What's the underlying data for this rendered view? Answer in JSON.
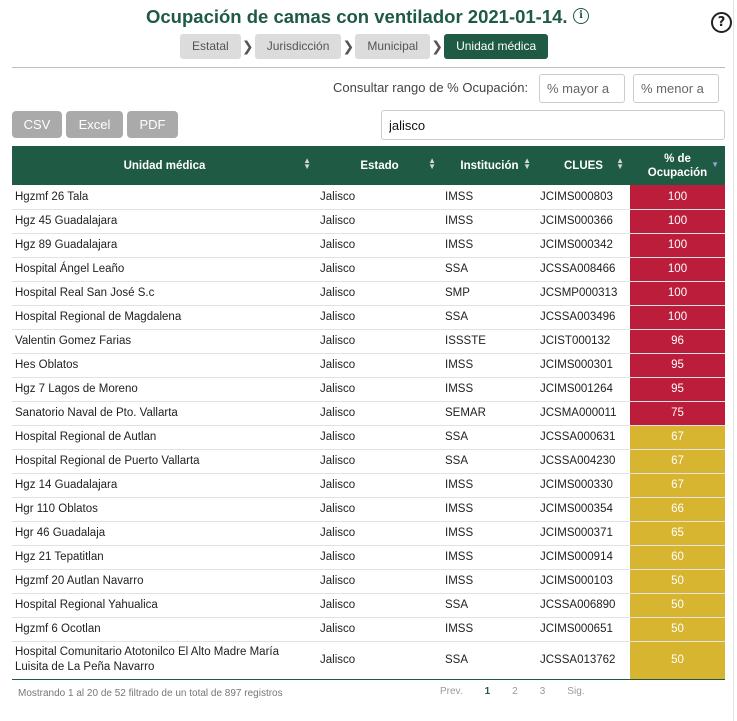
{
  "header": {
    "title": "Ocupación de camas con ventilador 2021-01-14.",
    "info_icon": "i",
    "help_icon": "?"
  },
  "breadcrumbs": [
    {
      "label": "Estatal",
      "active": false
    },
    {
      "label": "Jurisdicción",
      "active": false
    },
    {
      "label": "Municipal",
      "active": false
    },
    {
      "label": "Unidad médica",
      "active": true
    }
  ],
  "breadcrumb_separator": "❯",
  "range": {
    "label": "Consultar rango de % Ocupación:",
    "min_placeholder": "% mayor a",
    "max_placeholder": "% menor a"
  },
  "export_buttons": {
    "csv": "CSV",
    "excel": "Excel",
    "pdf": "PDF"
  },
  "search": {
    "value": "jalisco"
  },
  "table": {
    "columns": [
      "Unidad médica",
      "Estado",
      "Institución",
      "CLUES",
      "% de Ocupación"
    ],
    "rows": [
      [
        "Hgzmf 26 Tala",
        "Jalisco",
        "IMSS",
        "JCIMS000803",
        "100"
      ],
      [
        "Hgz 45 Guadalajara",
        "Jalisco",
        "IMSS",
        "JCIMS000366",
        "100"
      ],
      [
        "Hgz 89 Guadalajara",
        "Jalisco",
        "IMSS",
        "JCIMS000342",
        "100"
      ],
      [
        "Hospital Ángel Leaño",
        "Jalisco",
        "SSA",
        "JCSSA008466",
        "100"
      ],
      [
        "Hospital Real San José S.c",
        "Jalisco",
        "SMP",
        "JCSMP000313",
        "100"
      ],
      [
        "Hospital Regional de Magdalena",
        "Jalisco",
        "SSA",
        "JCSSA003496",
        "100"
      ],
      [
        "Valentin Gomez Farias",
        "Jalisco",
        "ISSSTE",
        "JCIST000132",
        "96"
      ],
      [
        "Hes Oblatos",
        "Jalisco",
        "IMSS",
        "JCIMS000301",
        "95"
      ],
      [
        "Hgz 7 Lagos de Moreno",
        "Jalisco",
        "IMSS",
        "JCIMS001264",
        "95"
      ],
      [
        "Sanatorio Naval de Pto. Vallarta",
        "Jalisco",
        "SEMAR",
        "JCSMA000011",
        "75"
      ],
      [
        "Hospital Regional de Autlan",
        "Jalisco",
        "SSA",
        "JCSSA000631",
        "67"
      ],
      [
        "Hospital Regional de Puerto Vallarta",
        "Jalisco",
        "SSA",
        "JCSSA004230",
        "67"
      ],
      [
        "Hgz 14 Guadalajara",
        "Jalisco",
        "IMSS",
        "JCIMS000330",
        "67"
      ],
      [
        "Hgr 110 Oblatos",
        "Jalisco",
        "IMSS",
        "JCIMS000354",
        "66"
      ],
      [
        "Hgr 46 Guadalaja",
        "Jalisco",
        "IMSS",
        "JCIMS000371",
        "65"
      ],
      [
        "Hgz 21 Tepatitlan",
        "Jalisco",
        "IMSS",
        "JCIMS000914",
        "60"
      ],
      [
        "Hgzmf 20 Autlan Navarro",
        "Jalisco",
        "IMSS",
        "JCIMS000103",
        "50"
      ],
      [
        "Hospital Regional Yahualica",
        "Jalisco",
        "SSA",
        "JCSSA006890",
        "50"
      ],
      [
        "Hgzmf 6 Ocotlan",
        "Jalisco",
        "IMSS",
        "JCIMS000651",
        "50"
      ],
      [
        "Hospital Comunitario Atotonilco El Alto Madre María Luisita de La Peña Navarro",
        "Jalisco",
        "SSA",
        "JCSSA013762",
        "50"
      ]
    ]
  },
  "colors": {
    "high": "#bb1d3a",
    "medium": "#d7b531",
    "header": "#1f5a45"
  },
  "footer": {
    "info": "Mostrando 1 al 20 de 52 filtrado de un total de 897 registros",
    "pager": {
      "prev": "Prev.",
      "pages": [
        "1",
        "2",
        "3"
      ],
      "current": "1",
      "next": "Sig."
    }
  }
}
